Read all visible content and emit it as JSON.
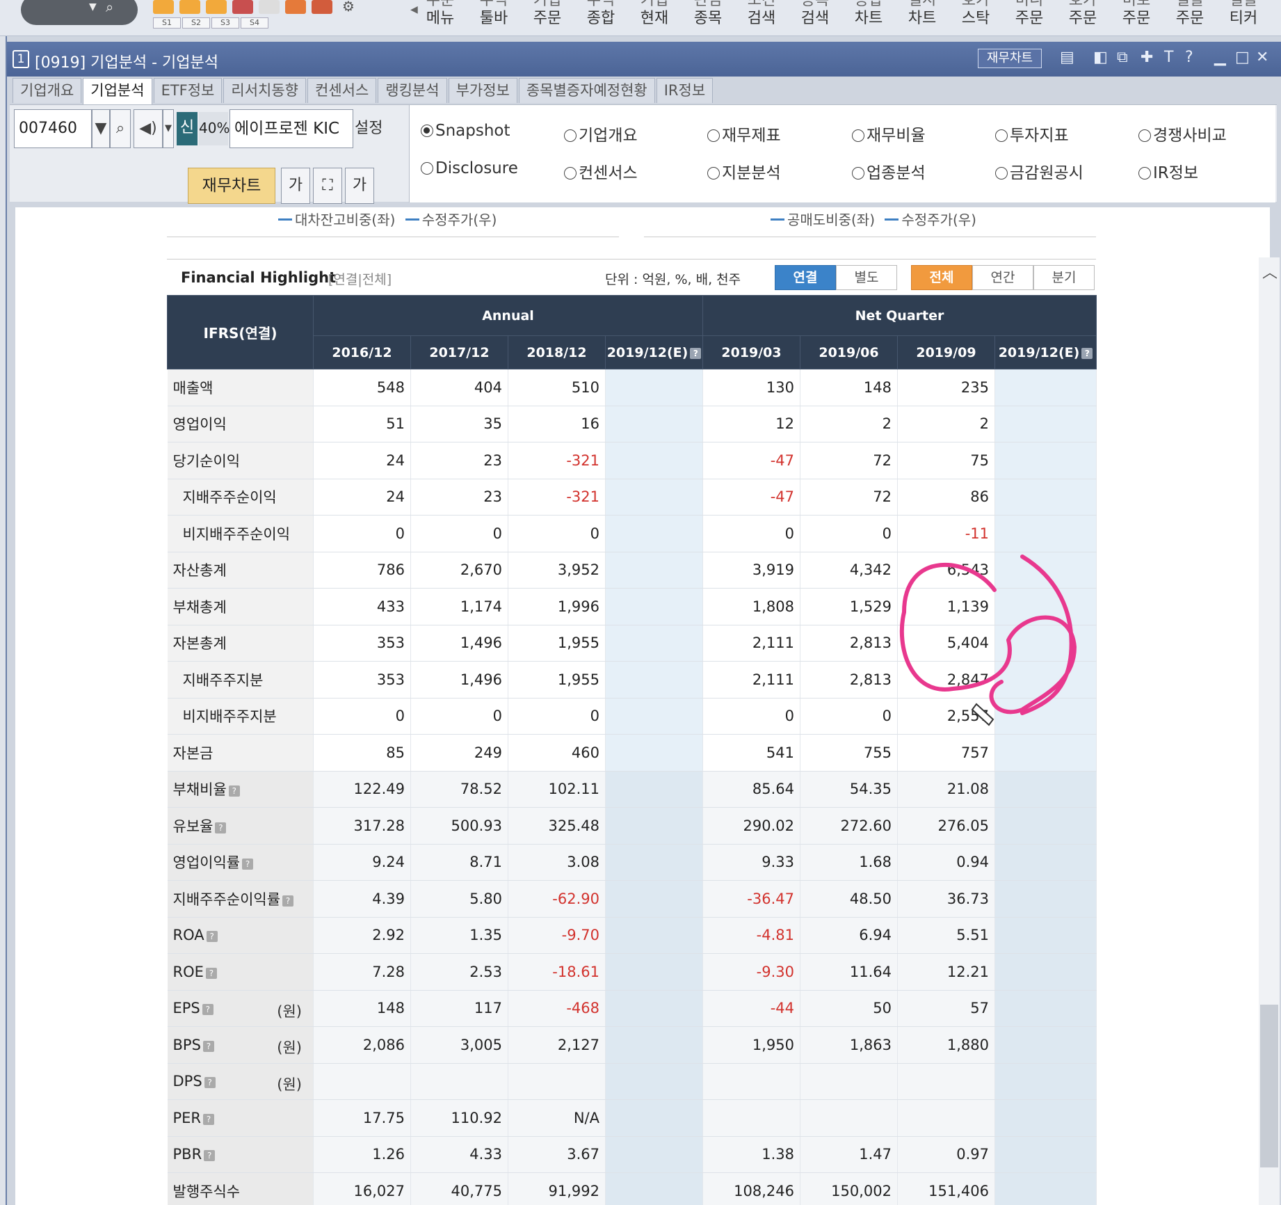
{
  "toolbar": {
    "menus": [
      {
        "l1": "주문",
        "l2": "메뉴"
      },
      {
        "l1": "주식",
        "l2": "툴바"
      },
      {
        "l1": "기업",
        "l2": "주문"
      },
      {
        "l1": "주식",
        "l2": "종합"
      },
      {
        "l1": "기업",
        "l2": "현재"
      },
      {
        "l1": "관심",
        "l2": "종목"
      },
      {
        "l1": "조건",
        "l2": "검색"
      },
      {
        "l1": "종목",
        "l2": "검색"
      },
      {
        "l1": "종합",
        "l2": "차트"
      },
      {
        "l1": "실시",
        "l2": "차트"
      },
      {
        "l1": "호가",
        "l2": "스탁"
      },
      {
        "l1": "미니",
        "l2": "주문"
      },
      {
        "l1": "호가",
        "l2": "주문"
      },
      {
        "l1": "미로",
        "l2": "주문"
      },
      {
        "l1": "일괄",
        "l2": "주문"
      },
      {
        "l1": "일괄",
        "l2": "티커"
      }
    ],
    "slots": [
      "S1",
      "S2",
      "S3",
      "S4"
    ]
  },
  "window": {
    "number": "1",
    "title": "[0919] 기업분석 - 기업분석",
    "chart_button": "재무차트"
  },
  "tabs": [
    "기업개요",
    "기업분석",
    "ETF정보",
    "리서치동향",
    "컨센서스",
    "랭킹분석",
    "부가정보",
    "종목별증자예정현황",
    "IR정보"
  ],
  "controls": {
    "code": "007460",
    "new_badge": "신",
    "percent": "40%",
    "company": "에이프로젠 KIC",
    "settings": "설정",
    "fin_chart": "재무차트",
    "radios_row1": [
      "Snapshot",
      "기업개요",
      "재무제표",
      "재무비율",
      "투자지표",
      "경쟁사비교"
    ],
    "radios_row2": [
      "Disclosure",
      "컨센서스",
      "지분분석",
      "업종분석",
      "금감원공시",
      "IR정보"
    ],
    "selected": "Snapshot"
  },
  "legends": {
    "left": [
      "대차잔고비중(좌)",
      "수정주가(우)"
    ],
    "right": [
      "공매도비중(좌)",
      "수정주가(우)"
    ]
  },
  "highlight": {
    "title": "Financial Highlight",
    "subtitle": "[연결|전체]",
    "unit": "단위 : 억원, %, 배, 천주",
    "btn_consol": "연결",
    "btn_separate": "별도",
    "btn_all": "전체",
    "btn_annual": "연간",
    "btn_quarter": "분기"
  },
  "table": {
    "corner": "IFRS(연결)",
    "group_annual": "Annual",
    "group_quarter": "Net Quarter",
    "columns": [
      "2016/12",
      "2017/12",
      "2018/12",
      "2019/12(E)",
      "2019/03",
      "2019/06",
      "2019/09",
      "2019/12(E)"
    ],
    "rows": [
      {
        "label": "매출액",
        "values": [
          "548",
          "404",
          "510",
          "",
          "130",
          "148",
          "235",
          ""
        ]
      },
      {
        "label": "영업이익",
        "values": [
          "51",
          "35",
          "16",
          "",
          "12",
          "2",
          "2",
          ""
        ]
      },
      {
        "label": "당기순이익",
        "values": [
          "24",
          "23",
          "-321",
          "",
          "-47",
          "72",
          "75",
          ""
        ]
      },
      {
        "label": "지배주주순이익",
        "sub": true,
        "values": [
          "24",
          "23",
          "-321",
          "",
          "-47",
          "72",
          "86",
          ""
        ]
      },
      {
        "label": "비지배주주순이익",
        "sub": true,
        "values": [
          "0",
          "0",
          "0",
          "",
          "0",
          "0",
          "-11",
          ""
        ]
      },
      {
        "label": "자산총계",
        "values": [
          "786",
          "2,670",
          "3,952",
          "",
          "3,919",
          "4,342",
          "6,543",
          ""
        ]
      },
      {
        "label": "부채총계",
        "values": [
          "433",
          "1,174",
          "1,996",
          "",
          "1,808",
          "1,529",
          "1,139",
          ""
        ]
      },
      {
        "label": "자본총계",
        "values": [
          "353",
          "1,496",
          "1,955",
          "",
          "2,111",
          "2,813",
          "5,404",
          ""
        ]
      },
      {
        "label": "지배주주지분",
        "sub": true,
        "values": [
          "353",
          "1,496",
          "1,955",
          "",
          "2,111",
          "2,813",
          "2,847",
          ""
        ]
      },
      {
        "label": "비지배주주지분",
        "sub": true,
        "values": [
          "0",
          "0",
          "0",
          "",
          "0",
          "0",
          "2,557",
          ""
        ]
      },
      {
        "label": "자본금",
        "values": [
          "85",
          "249",
          "460",
          "",
          "541",
          "755",
          "757",
          ""
        ]
      },
      {
        "label": "부채비율",
        "help": true,
        "alt": true,
        "values": [
          "122.49",
          "78.52",
          "102.11",
          "",
          "85.64",
          "54.35",
          "21.08",
          ""
        ]
      },
      {
        "label": "유보율",
        "help": true,
        "alt": true,
        "values": [
          "317.28",
          "500.93",
          "325.48",
          "",
          "290.02",
          "272.60",
          "276.05",
          ""
        ]
      },
      {
        "label": "영업이익률",
        "help": true,
        "alt": true,
        "values": [
          "9.24",
          "8.71",
          "3.08",
          "",
          "9.33",
          "1.68",
          "0.94",
          ""
        ]
      },
      {
        "label": "지배주주순이익률",
        "help": true,
        "alt": true,
        "values": [
          "4.39",
          "5.80",
          "-62.90",
          "",
          "-36.47",
          "48.50",
          "36.73",
          ""
        ]
      },
      {
        "label": "ROA",
        "help": true,
        "alt": true,
        "values": [
          "2.92",
          "1.35",
          "-9.70",
          "",
          "-4.81",
          "6.94",
          "5.51",
          ""
        ]
      },
      {
        "label": "ROE",
        "help": true,
        "alt": true,
        "values": [
          "7.28",
          "2.53",
          "-18.61",
          "",
          "-9.30",
          "11.64",
          "12.21",
          ""
        ]
      },
      {
        "label": "EPS",
        "help": true,
        "unit": "(원)",
        "alt": true,
        "values": [
          "148",
          "117",
          "-468",
          "",
          "-44",
          "50",
          "57",
          ""
        ]
      },
      {
        "label": "BPS",
        "help": true,
        "unit": "(원)",
        "alt": true,
        "values": [
          "2,086",
          "3,005",
          "2,127",
          "",
          "1,950",
          "1,863",
          "1,880",
          ""
        ]
      },
      {
        "label": "DPS",
        "help": true,
        "unit": "(원)",
        "alt": true,
        "values": [
          "",
          "",
          "",
          "",
          "",
          "",
          "",
          ""
        ]
      },
      {
        "label": "PER",
        "help": true,
        "alt": true,
        "values": [
          "17.75",
          "110.92",
          "N/A",
          "",
          "",
          "",
          "",
          ""
        ]
      },
      {
        "label": "PBR",
        "help": true,
        "alt": true,
        "values": [
          "1.26",
          "4.33",
          "3.67",
          "",
          "1.38",
          "1.47",
          "0.97",
          ""
        ]
      },
      {
        "label": "발행주식수",
        "alt": true,
        "values": [
          "16,027",
          "40,775",
          "91,992",
          "",
          "108,246",
          "150,002",
          "151,406",
          ""
        ]
      }
    ]
  },
  "colors": {
    "title_bar": "#4b6496",
    "header": "#2f3e52",
    "negative": "#d2322d",
    "annotation": "#e8388e",
    "btn_blue": "#3b83c9",
    "btn_orange": "#f19a3e"
  }
}
